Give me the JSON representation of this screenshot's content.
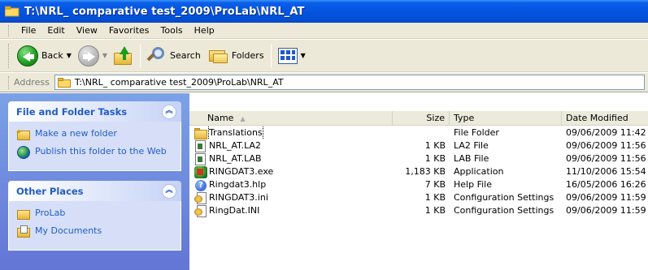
{
  "window": {
    "title": "T:\\NRL_ comparative test_2009\\ProLab\\NRL_AT"
  },
  "menu": [
    {
      "label": "File"
    },
    {
      "label": "Edit"
    },
    {
      "label": "View"
    },
    {
      "label": "Favorites"
    },
    {
      "label": "Tools"
    },
    {
      "label": "Help"
    }
  ],
  "toolbar": {
    "back_label": "Back",
    "search_label": "Search",
    "folders_label": "Folders"
  },
  "address": {
    "label": "Address",
    "path": "T:\\NRL_ comparative test_2009\\ProLab\\NRL_AT"
  },
  "taskpane": {
    "file_tasks": {
      "title": "File and Folder Tasks",
      "items": [
        {
          "label": "Make a new folder"
        },
        {
          "label": "Publish this folder to the Web"
        }
      ]
    },
    "other_places": {
      "title": "Other Places",
      "items": [
        {
          "label": "ProLab"
        },
        {
          "label": "My Documents"
        }
      ]
    }
  },
  "columns": {
    "name": "Name",
    "size": "Size",
    "type": "Type",
    "date": "Date Modified"
  },
  "files": [
    {
      "name": "Translations",
      "size": "",
      "type": "File Folder",
      "date": "09/06/2009 11:42",
      "icon": "folder-icon"
    },
    {
      "name": "NRL_AT.LA2",
      "size": "1 KB",
      "type": "LA2 File",
      "date": "09/06/2009 11:56",
      "icon": "document-icon"
    },
    {
      "name": "NRL_AT.LAB",
      "size": "1 KB",
      "type": "LAB File",
      "date": "09/06/2009 11:56",
      "icon": "document-icon"
    },
    {
      "name": "RINGDAT3.exe",
      "size": "1,183 KB",
      "type": "Application",
      "date": "11/10/2006 15:54",
      "icon": "application-icon"
    },
    {
      "name": "Ringdat3.hlp",
      "size": "7 KB",
      "type": "Help File",
      "date": "16/05/2006 16:26",
      "icon": "help-file-icon"
    },
    {
      "name": "RINGDAT3.ini",
      "size": "1 KB",
      "type": "Configuration Settings",
      "date": "09/06/2009 11:59",
      "icon": "config-settings-icon"
    },
    {
      "name": "RingDat.INI",
      "size": "1 KB",
      "type": "Configuration Settings",
      "date": "09/06/2009 11:59",
      "icon": "config-settings-icon"
    }
  ]
}
